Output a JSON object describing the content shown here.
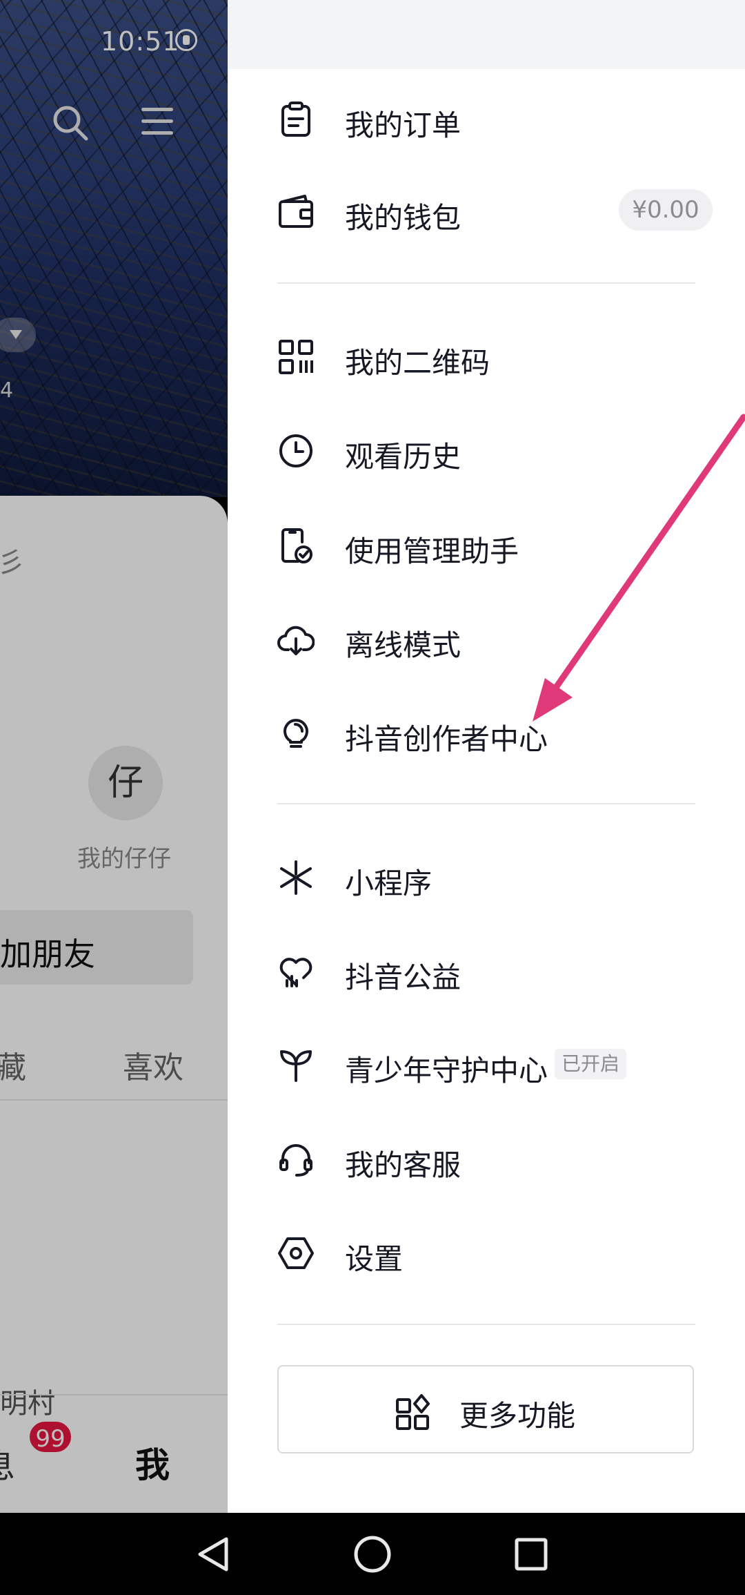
{
  "status_bar": {
    "time": "10:51"
  },
  "profile_bg": {
    "id_fragment": "4 ",
    "card_fragment": "彡",
    "avatar_char": "仔",
    "avatar_label": "我的仔仔",
    "add_friend": "加朋友",
    "tabs": [
      "藏",
      "喜欢"
    ],
    "bottom_fragment": "明村",
    "nav": {
      "messages": "息",
      "badge": "99",
      "me": "我"
    }
  },
  "drawer": {
    "items": [
      {
        "label": "我的订单",
        "icon": "clipboard-icon"
      },
      {
        "label": "我的钱包",
        "icon": "wallet-icon",
        "badge": "¥0.00"
      },
      {
        "label": "我的二维码",
        "icon": "qrcode-icon"
      },
      {
        "label": "观看历史",
        "icon": "clock-icon"
      },
      {
        "label": "使用管理助手",
        "icon": "phone-check-icon"
      },
      {
        "label": "离线模式",
        "icon": "cloud-download-icon"
      },
      {
        "label": "抖音创作者中心",
        "icon": "lightbulb-icon"
      },
      {
        "label": "小程序",
        "icon": "miniprogram-icon"
      },
      {
        "label": "抖音公益",
        "icon": "heart-chart-icon"
      },
      {
        "label": "青少年守护中心",
        "icon": "sprout-icon",
        "badge": "已开启"
      },
      {
        "label": "我的客服",
        "icon": "headset-icon"
      },
      {
        "label": "设置",
        "icon": "gear-hex-icon"
      }
    ],
    "more_button": "更多功能"
  },
  "colors": {
    "accent_arrow": "#e0397a",
    "badge_red": "#e8163f"
  }
}
